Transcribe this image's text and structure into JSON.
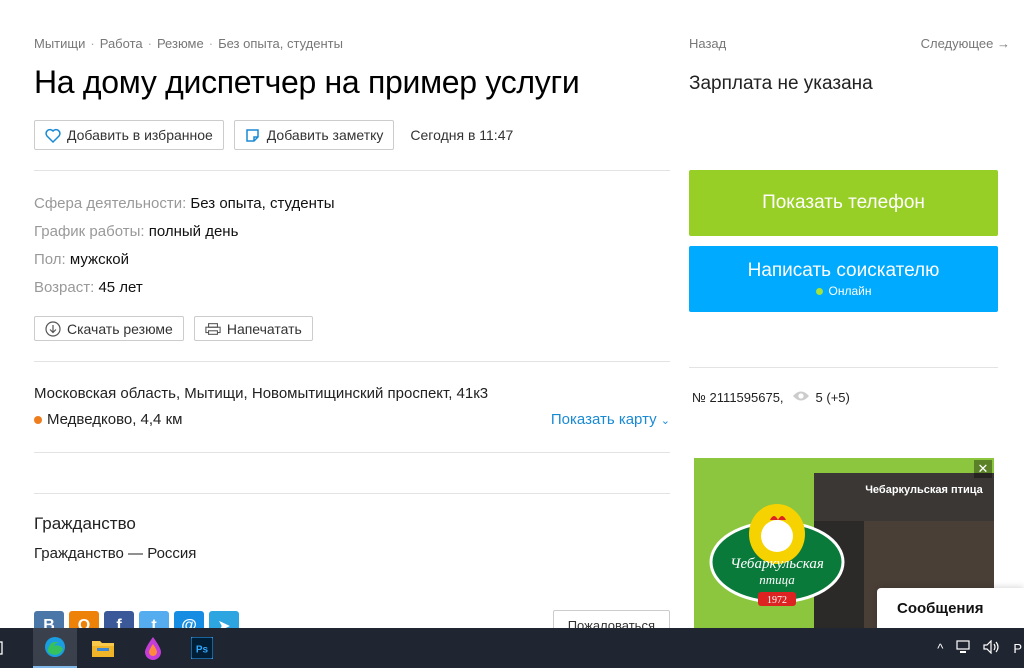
{
  "breadcrumb": [
    "Мытищи",
    "Работа",
    "Резюме",
    "Без опыта, студенты"
  ],
  "title": "На дому диспетчер на пример услуги",
  "actions": {
    "favorite": "Добавить в избранное",
    "note": "Добавить заметку",
    "date": "Сегодня в 11:47"
  },
  "props": [
    {
      "key": "Сфера деятельности:",
      "value": "Без опыта, студенты"
    },
    {
      "key": "График работы:",
      "value": "полный день"
    },
    {
      "key": "Пол:",
      "value": "мужской"
    },
    {
      "key": "Возраст:",
      "value": "45 лет"
    }
  ],
  "actions2": {
    "download": "Скачать резюме",
    "print": "Напечатать"
  },
  "address": "Московская область, Мытищи, Новомытищинский проспект, 41к3",
  "metro": "Медведково, 4,4 км",
  "show_map": "Показать карту",
  "citizenship": {
    "heading": "Гражданство",
    "value": "Гражданство — Россия"
  },
  "report": "Пожаловаться",
  "nav": {
    "back": "Назад",
    "next": "Следующее →"
  },
  "salary": "Зарплата не указана",
  "phone_button": "Показать телефон",
  "message_button": {
    "label": "Написать соискателю",
    "status": "Онлайн"
  },
  "meta": {
    "number": "№ 2111595675,",
    "views": "5 (+5)"
  },
  "ad": {
    "sign": "Чебаркульская птица",
    "logo_line1": "Чебаркульская",
    "logo_line2": "птица",
    "year": "1972",
    "close": "✕"
  },
  "messages": "Сообщения",
  "tray": {
    "lang": "Р"
  },
  "colors": {
    "green": "#97cf26",
    "blue": "#00aaff",
    "link": "#1a8ad4",
    "metro": "#f07d1d"
  }
}
